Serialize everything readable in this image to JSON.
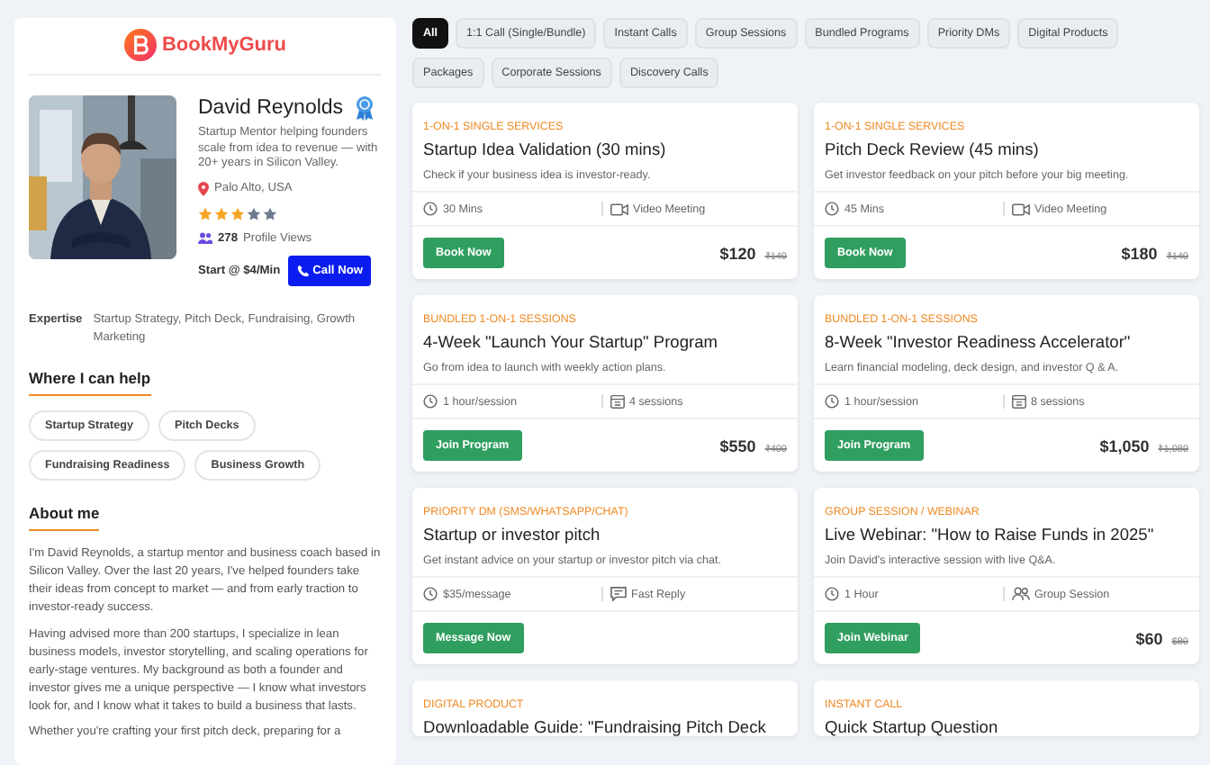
{
  "brand": {
    "name": "BookMyGuru"
  },
  "profile": {
    "name": "David Reynolds",
    "verified": true,
    "tagline": "Startup Mentor helping founders scale from idea to revenue — with 20+ years in Silicon Valley.",
    "location": "Palo Alto, USA",
    "stars": 3,
    "views_count": "278",
    "views_label": "Profile Views",
    "start_price": "Start @ $4/Min",
    "call_button": "Call Now"
  },
  "expertise": {
    "label": "Expertise",
    "value": "Startup Strategy, Pitch Deck, Fundraising, Growth Marketing"
  },
  "help": {
    "title": "Where I can help",
    "tags": [
      "Startup Strategy",
      "Pitch Decks",
      "Fundraising Readiness",
      "Business Growth"
    ]
  },
  "about": {
    "title": "About me",
    "paragraphs": [
      "I'm David Reynolds, a startup mentor and business coach based in Silicon Valley. Over the last 20 years, I've helped founders take their ideas from concept to market — and from early traction to investor-ready success.",
      "Having advised more than 200 startups, I specialize in lean business models, investor storytelling, and scaling operations for early-stage ventures. My background as both a founder and investor gives me a unique perspective — I know what investors look for, and I know what it takes to build a business that lasts.",
      "Whether you're crafting your first pitch deck, preparing for a"
    ]
  },
  "filters": [
    {
      "label": "All",
      "selected": true
    },
    {
      "label": "1:1 Call (Single/Bundle)",
      "selected": false
    },
    {
      "label": "Instant Calls",
      "selected": false
    },
    {
      "label": "Group Sessions",
      "selected": false
    },
    {
      "label": "Bundled Programs",
      "selected": false
    },
    {
      "label": "Priority DMs",
      "selected": false
    },
    {
      "label": "Digital Products",
      "selected": false
    },
    {
      "label": "Packages",
      "selected": false
    },
    {
      "label": "Corporate Sessions",
      "selected": false
    },
    {
      "label": "Discovery Calls",
      "selected": false
    }
  ],
  "services": [
    {
      "category": "1-ON-1 SINGLE SERVICES",
      "title": "Startup Idea Validation (30 mins)",
      "description": "Check if your business idea is investor-ready.",
      "meta": [
        {
          "kind": "clock",
          "text": "30 Mins"
        },
        {
          "kind": "video",
          "text": "Video Meeting"
        }
      ],
      "button": "Book Now",
      "price": "$120",
      "old_price": "₹140"
    },
    {
      "category": "1-ON-1 SINGLE SERVICES",
      "title": "Pitch Deck Review (45 mins)",
      "description": "Get investor feedback on your pitch before your big meeting.",
      "meta": [
        {
          "kind": "clock",
          "text": "45 Mins"
        },
        {
          "kind": "video",
          "text": "Video Meeting"
        }
      ],
      "button": "Book Now",
      "price": "$180",
      "old_price": "₹140"
    },
    {
      "category": "BUNDLED 1-ON-1 SESSIONS",
      "title": "4-Week \"Launch Your Startup\" Program",
      "description": "Go from idea to launch with weekly action plans.",
      "meta": [
        {
          "kind": "clock",
          "text": "1 hour/session"
        },
        {
          "kind": "calendar",
          "text": "4 sessions"
        }
      ],
      "button": "Join Program",
      "price": "$550",
      "old_price": "₹400"
    },
    {
      "category": "BUNDLED 1-ON-1 SESSIONS",
      "title": "8-Week \"Investor Readiness Accelerator\"",
      "description": "Learn financial modeling, deck design, and investor Q & A.",
      "meta": [
        {
          "kind": "clock",
          "text": "1 hour/session"
        },
        {
          "kind": "calendar",
          "text": "8 sessions"
        }
      ],
      "button": "Join Program",
      "price": "$1,050",
      "old_price": "₹1,080"
    },
    {
      "category": "PRIORITY DM (SMS/WHATSAPP/CHAT)",
      "title": "Startup or investor pitch",
      "description": "Get instant advice on your startup or investor pitch via chat.",
      "meta": [
        {
          "kind": "clock",
          "text": "$35/message"
        },
        {
          "kind": "chat",
          "text": "Fast Reply"
        }
      ],
      "button": "Message Now"
    },
    {
      "category": "GROUP SESSION / WEBINAR",
      "title": "Live Webinar: \"How to Raise Funds in 2025\"",
      "description": "Join David's interactive session with live Q&A.",
      "meta": [
        {
          "kind": "clock",
          "text": "1 Hour"
        },
        {
          "kind": "group",
          "text": "Group Session"
        }
      ],
      "button": "Join Webinar",
      "price": "$60",
      "old_price": "$80"
    },
    {
      "category": "DIGITAL PRODUCT",
      "title": "Downloadable Guide: \"Fundraising Pitch Deck"
    },
    {
      "category": "INSTANT CALL",
      "title": "Quick Startup Question"
    }
  ]
}
